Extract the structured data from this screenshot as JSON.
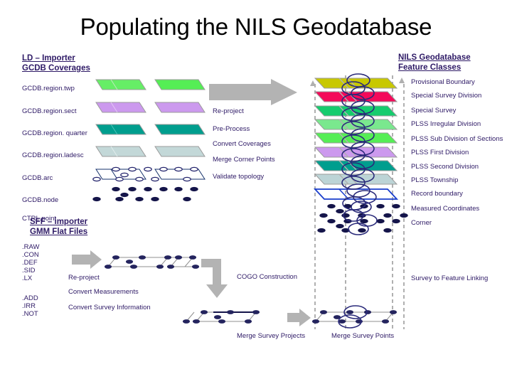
{
  "slide": {
    "title": "Populating the NILS Geodatabase"
  },
  "left_panel": {
    "heading_line1": "LD – Importer",
    "heading_line2": "GCDB Coverages",
    "coverages": [
      {
        "label": "GCDB.region.twp",
        "color": "#66ee66",
        "type": "polygon"
      },
      {
        "label": "GCDB.region.sect",
        "color": "#cc99ee",
        "type": "polygon"
      },
      {
        "label": "GCDB.region. quarter",
        "color": "#009e8e",
        "type": "polygon"
      },
      {
        "label": "GCDB.region.ladesc",
        "color": "#c3d8d8",
        "type": "polygon"
      },
      {
        "label": "GCDB.arc",
        "color": "#ffffff",
        "type": "outline"
      },
      {
        "label": "GCDB.node",
        "color": "#ffffff",
        "type": "node"
      },
      {
        "label": "CTRL.point",
        "color": "#111133",
        "type": "point"
      }
    ]
  },
  "center_processes": {
    "items": [
      "Re-project",
      "Pre-Process",
      "Convert Coverages",
      "Merge Corner Points",
      "Validate topology"
    ]
  },
  "right_panel": {
    "heading_line1": "NILS Geodatabase",
    "heading_line2": "Feature Classes",
    "feature_classes": [
      {
        "label": "Provisional Boundary",
        "color": "#c8c800"
      },
      {
        "label": "Special Survey Division",
        "color": "#f40a5a"
      },
      {
        "label": "Special Survey",
        "color": "#16cc6e"
      },
      {
        "label": "PLSS Irregular Division",
        "color": "#7ae88e"
      },
      {
        "label": "PLSS Sub Division of Sections",
        "color": "#55ee55"
      },
      {
        "label": "PLSS First Division",
        "color": "#cc99ee"
      },
      {
        "label": "PLSS Second Division",
        "color": "#009e8e"
      },
      {
        "label": "PLSS Township",
        "color": "#bcd4d6"
      },
      {
        "label": "Record boundary",
        "color": "#ffffff"
      },
      {
        "label": "Measured Coordinates",
        "color": "#111133"
      },
      {
        "label": "Corner",
        "color": "#111133"
      }
    ]
  },
  "bottom_panel": {
    "heading_line1": "SFF – importer",
    "heading_line2": "GMM Flat Files",
    "file_group_1": [
      ".RAW",
      ".CON",
      ".DEF",
      ".SID",
      ".LX"
    ],
    "file_group_2": [
      ".ADD",
      ".IRR",
      ".NOT"
    ],
    "processes": [
      "Re-project",
      "Convert Measurements",
      "Convert Survey Information"
    ],
    "cogo_label": "COGO Construction",
    "merge_projects_label": "Merge Survey Projects",
    "merge_points_label": "Merge Survey Points",
    "linking_label": "Survey to Feature Linking"
  },
  "colors": {
    "text_navy": "#2e1a66",
    "arrow_gray": "#b3b3b3",
    "dash_gray": "#b0b0b0",
    "node_navy": "#22226b",
    "record_blue": "#1a3ecc"
  }
}
